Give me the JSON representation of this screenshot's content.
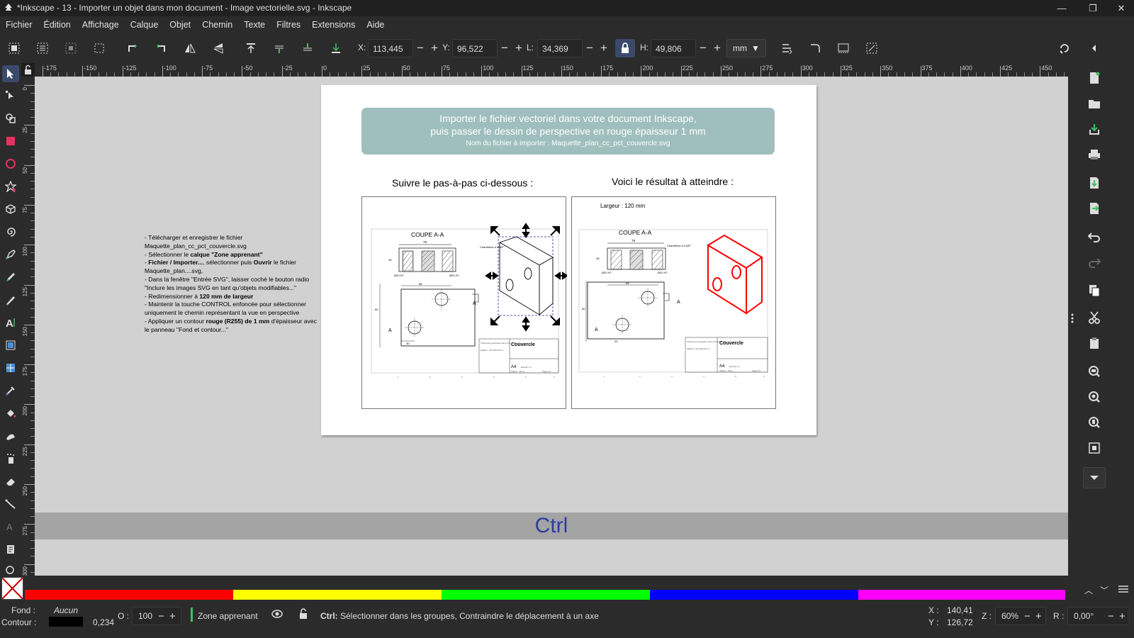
{
  "titlebar": {
    "title": "*Inkscape - 13 - Importer un objet dans mon document - Image vectorielle.svg - Inkscape",
    "minimize": "—",
    "maximize": "❐",
    "close": "✕"
  },
  "menu": [
    "Fichier",
    "Édition",
    "Affichage",
    "Calque",
    "Objet",
    "Chemin",
    "Texte",
    "Filtres",
    "Extensions",
    "Aide"
  ],
  "toolbar": {
    "x_label": "X:",
    "x_value": "113,445",
    "y_label": "Y:",
    "y_value": "96,522",
    "w_label": "L:",
    "w_value": "34,369",
    "h_label": "H:",
    "h_value": "49,806",
    "units": "mm"
  },
  "ruler": {
    "h_ticks": [
      "-175",
      "-150",
      "-125",
      "-100",
      "-75",
      "-50",
      "-25",
      "0",
      "25",
      "50",
      "75",
      "100",
      "125",
      "150",
      "175",
      "200",
      "225",
      "250",
      "275",
      "300",
      "325",
      "350",
      "375",
      "400",
      "425",
      "450"
    ],
    "v_ticks": [
      "0",
      "25",
      "50",
      "75",
      "100",
      "125",
      "150",
      "175",
      "200",
      "225",
      "250",
      "275",
      "300"
    ]
  },
  "page": {
    "banner_line1": "Importer le fichier vectoriel dans votre document Inkscape,",
    "banner_line2": "puis passer le dessin de perspective en rouge épaisseur 1 mm",
    "banner_line3": "Nom du fichier à importer : Maquette_plan_cc_pct_couvercle.svg",
    "left_heading": "Suivre le pas-à-pas ci-dessous :",
    "right_heading": "Voici le résultat à atteindre :",
    "largeur": "Largeur : 120 mm"
  },
  "drawing": {
    "coupe": "COUPE A-A",
    "chanfreins": "Chanfreins à 1x45°",
    "dim_78": "78",
    "dim_58": "58",
    "dim_60": "60",
    "dim_30": "30",
    "dim_28": "28",
    "dim_20": "20",
    "dim_hole1": "Ø20 H7",
    "dim_hole2": "Ø20 H7",
    "section_a": "A",
    "title": "Couvercle",
    "fmt": "A4",
    "tol_note": "Tolérances générales selon ISO 2768-mK",
    "mat_note": "Matière : EN AW-2017 A",
    "scale_note": "Échelle 1:1",
    "mass_note": "Masse : 434 g",
    "page_note": "Page 1/1",
    "bottom_nums": [
      "1",
      "2",
      "3",
      "4",
      "5",
      "6"
    ]
  },
  "instructions": [
    {
      "parts": [
        {
          "t": " - Télécharger et enregistrer le fichier",
          "b": false
        }
      ]
    },
    {
      "parts": [
        {
          "t": "Maquette_plan_cc_pct_couvercle.svg",
          "b": false
        }
      ]
    },
    {
      "parts": [
        {
          "t": "- Sélectionner le ",
          "b": false
        },
        {
          "t": "calque \"Zone apprenant\"",
          "b": true
        }
      ]
    },
    {
      "parts": [
        {
          "t": "- ",
          "b": false
        },
        {
          "t": "Fichier / Importer...",
          "b": true
        },
        {
          "t": ", sélectionner puis ",
          "b": false
        },
        {
          "t": "Ouvrir",
          "b": true
        },
        {
          "t": " le fichier",
          "b": false
        }
      ]
    },
    {
      "parts": [
        {
          "t": "Maquette_plan....svg,",
          "b": false
        }
      ]
    },
    {
      "parts": [
        {
          "t": "- Dans la fenêtre \"Entrée SVG\", laisser coché le bouton radio",
          "b": false
        }
      ]
    },
    {
      "parts": [
        {
          "t": "\"Inclure les images SVG en tant qu'objets modifiables...\"",
          "b": false
        }
      ]
    },
    {
      "parts": [
        {
          "t": "- Redimensionner à ",
          "b": false
        },
        {
          "t": "120 mm de largeur",
          "b": true
        }
      ]
    },
    {
      "parts": [
        {
          "t": "- Maintenir la touche CONTROL enfoncée pour sélectionner",
          "b": false
        }
      ]
    },
    {
      "parts": [
        {
          "t": "uniquement le chemin représentant la vue en perspective",
          "b": false
        }
      ]
    },
    {
      "parts": [
        {
          "t": "- Appliquer un contour ",
          "b": false
        },
        {
          "t": "rouge (R255) de 1 mm",
          "b": true
        },
        {
          "t": " d'épaisseur avec",
          "b": false
        }
      ]
    },
    {
      "parts": [
        {
          "t": "le panneau \"Fond et contour...\"",
          "b": false
        }
      ]
    }
  ],
  "keyhint": "Ctrl",
  "palette": {
    "colors": [
      "#ff0000",
      "#ffff00",
      "#00ff00",
      "#0000ff",
      "#ff00ff"
    ]
  },
  "status": {
    "fill_label": "Fond :",
    "fill_value": "Aucun",
    "stroke_label": "Contour :",
    "stroke_width": "0,234",
    "opacity_label": "O :",
    "opacity_value": "100",
    "layer": "Zone apprenant",
    "message_bold": "Ctrl:",
    "message": " Sélectionner dans les groupes, Contraindre le déplacement à un axe",
    "x_label": "X :",
    "x_value": "140,41",
    "y_label": "Y :",
    "y_value": "126,72",
    "zoom_label": "Z :",
    "zoom_value": "60%",
    "rot_label": "R :",
    "rot_value": "0,00°"
  }
}
